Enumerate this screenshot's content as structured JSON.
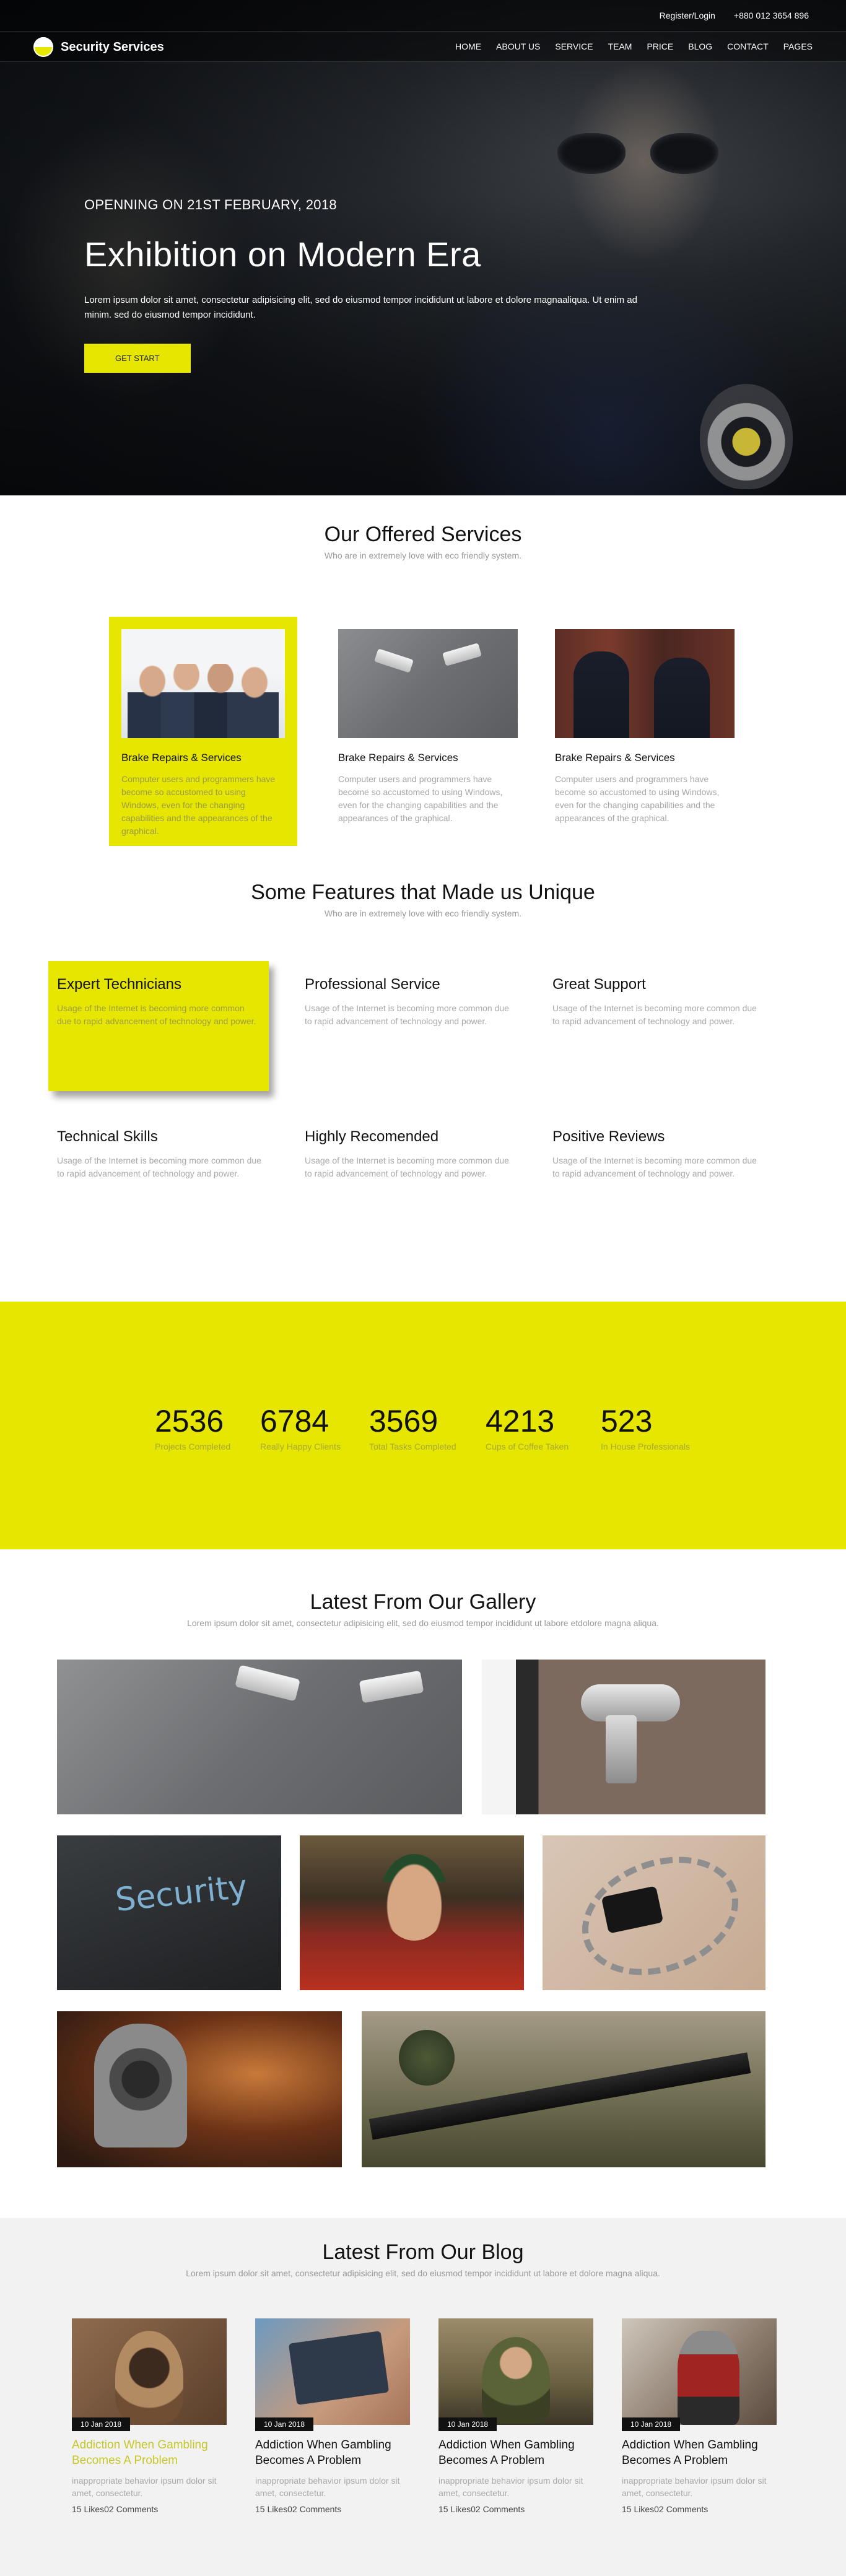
{
  "topbar": {
    "register": "Register/Login",
    "phone": "+880 012 3654 896"
  },
  "brand": {
    "name": "Security Services"
  },
  "menu": [
    "HOME",
    "ABOUT US",
    "SERVICE",
    "TEAM",
    "PRICE",
    "BLOG",
    "CONTACT",
    "PAGES"
  ],
  "hero": {
    "date": "OPENNING ON 21ST FEBRUARY, 2018",
    "title": "Exhibition on Modern Era",
    "text": "Lorem ipsum dolor sit amet, consectetur adipisicing elit, sed do eiusmod tempor incididunt ut labore et dolore magnaaliqua. Ut enim ad minim. sed do eiusmod tempor incididunt.",
    "button": "GET START"
  },
  "services": {
    "title": "Our Offered Services",
    "subtitle": "Who are in extremely love with eco friendly system.",
    "items": [
      {
        "name": "Brake Repairs & Services",
        "desc": "Computer users and programmers have become so accustomed to using Windows, even for the changing capabilities and the appearances of the graphical."
      },
      {
        "name": "Brake Repairs & Services",
        "desc": "Computer users and programmers have become so accustomed to using Windows, even for the changing capabilities and the appearances of the graphical."
      },
      {
        "name": "Brake Repairs & Services",
        "desc": "Computer users and programmers have become so accustomed to using Windows, even for the changing capabilities and the appearances of the graphical."
      }
    ]
  },
  "features": {
    "title": "Some Features that Made us Unique",
    "subtitle": "Who are in extremely love with eco friendly system.",
    "items": [
      {
        "title": "Expert Technicians",
        "desc": "Usage of the Internet is becoming more common due to rapid advancement of technology and power."
      },
      {
        "title": "Professional Service",
        "desc": "Usage of the Internet is becoming more common due to rapid advancement of technology and power."
      },
      {
        "title": "Great Support",
        "desc": "Usage of the Internet is becoming more common due to rapid advancement of technology and power."
      },
      {
        "title": "Technical Skills",
        "desc": "Usage of the Internet is becoming more common due to rapid advancement of technology and power."
      },
      {
        "title": "Highly Recomended",
        "desc": "Usage of the Internet is becoming more common due to rapid advancement of technology and power."
      },
      {
        "title": "Positive Reviews",
        "desc": "Usage of the Internet is becoming more common due to rapid advancement of technology and power."
      }
    ]
  },
  "counters": [
    {
      "value": "2536",
      "label": "Projects Completed"
    },
    {
      "value": "6784",
      "label": "Really Happy Clients"
    },
    {
      "value": "3569",
      "label": "Total Tasks Completed"
    },
    {
      "value": "4213",
      "label": "Cups of Coffee Taken"
    },
    {
      "value": "523",
      "label": "In House Professionals"
    }
  ],
  "gallery": {
    "title": "Latest From Our Gallery",
    "subtitle": "Lorem ipsum dolor sit amet, consectetur adipisicing elit, sed do eiusmod tempor incididunt ut labore etdolore magna aliqua.",
    "security_text": "Security"
  },
  "blog": {
    "title": "Latest From Our Blog",
    "subtitle": "Lorem ipsum dolor sit amet, consectetur adipisicing elit, sed do eiusmod tempor incididunt ut labore et dolore magna aliqua.",
    "posts": [
      {
        "date": "10 Jan 2018",
        "title": "Addiction When Gambling Becomes A Problem",
        "excerpt": "inappropriate behavior ipsum dolor sit amet, consectetur.",
        "meta": "15 Likes02 Comments"
      },
      {
        "date": "10 Jan 2018",
        "title": "Addiction When Gambling Becomes A Problem",
        "excerpt": "inappropriate behavior ipsum dolor sit amet, consectetur.",
        "meta": "15 Likes02 Comments"
      },
      {
        "date": "10 Jan 2018",
        "title": "Addiction When Gambling Becomes A Problem",
        "excerpt": "inappropriate behavior ipsum dolor sit amet, consectetur.",
        "meta": "15 Likes02 Comments"
      },
      {
        "date": "10 Jan 2018",
        "title": "Addiction When Gambling Becomes A Problem",
        "excerpt": "inappropriate behavior ipsum dolor sit amet, consectetur.",
        "meta": "15 Likes02 Comments"
      }
    ]
  },
  "colors": {
    "accent": "#e6e600",
    "dark": "#111111",
    "muted": "#aaaaaa"
  }
}
